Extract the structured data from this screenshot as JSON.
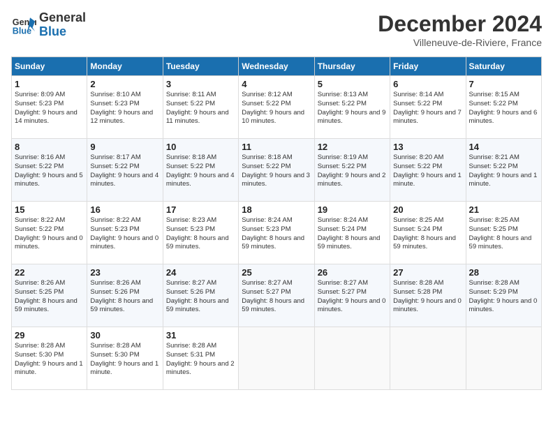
{
  "header": {
    "logo_general": "General",
    "logo_blue": "Blue",
    "month_title": "December 2024",
    "subtitle": "Villeneuve-de-Riviere, France"
  },
  "weekdays": [
    "Sunday",
    "Monday",
    "Tuesday",
    "Wednesday",
    "Thursday",
    "Friday",
    "Saturday"
  ],
  "weeks": [
    [
      {
        "day": "1",
        "sunrise": "Sunrise: 8:09 AM",
        "sunset": "Sunset: 5:23 PM",
        "daylight": "Daylight: 9 hours and 14 minutes."
      },
      {
        "day": "2",
        "sunrise": "Sunrise: 8:10 AM",
        "sunset": "Sunset: 5:23 PM",
        "daylight": "Daylight: 9 hours and 12 minutes."
      },
      {
        "day": "3",
        "sunrise": "Sunrise: 8:11 AM",
        "sunset": "Sunset: 5:22 PM",
        "daylight": "Daylight: 9 hours and 11 minutes."
      },
      {
        "day": "4",
        "sunrise": "Sunrise: 8:12 AM",
        "sunset": "Sunset: 5:22 PM",
        "daylight": "Daylight: 9 hours and 10 minutes."
      },
      {
        "day": "5",
        "sunrise": "Sunrise: 8:13 AM",
        "sunset": "Sunset: 5:22 PM",
        "daylight": "Daylight: 9 hours and 9 minutes."
      },
      {
        "day": "6",
        "sunrise": "Sunrise: 8:14 AM",
        "sunset": "Sunset: 5:22 PM",
        "daylight": "Daylight: 9 hours and 7 minutes."
      },
      {
        "day": "7",
        "sunrise": "Sunrise: 8:15 AM",
        "sunset": "Sunset: 5:22 PM",
        "daylight": "Daylight: 9 hours and 6 minutes."
      }
    ],
    [
      {
        "day": "8",
        "sunrise": "Sunrise: 8:16 AM",
        "sunset": "Sunset: 5:22 PM",
        "daylight": "Daylight: 9 hours and 5 minutes."
      },
      {
        "day": "9",
        "sunrise": "Sunrise: 8:17 AM",
        "sunset": "Sunset: 5:22 PM",
        "daylight": "Daylight: 9 hours and 4 minutes."
      },
      {
        "day": "10",
        "sunrise": "Sunrise: 8:18 AM",
        "sunset": "Sunset: 5:22 PM",
        "daylight": "Daylight: 9 hours and 4 minutes."
      },
      {
        "day": "11",
        "sunrise": "Sunrise: 8:18 AM",
        "sunset": "Sunset: 5:22 PM",
        "daylight": "Daylight: 9 hours and 3 minutes."
      },
      {
        "day": "12",
        "sunrise": "Sunrise: 8:19 AM",
        "sunset": "Sunset: 5:22 PM",
        "daylight": "Daylight: 9 hours and 2 minutes."
      },
      {
        "day": "13",
        "sunrise": "Sunrise: 8:20 AM",
        "sunset": "Sunset: 5:22 PM",
        "daylight": "Daylight: 9 hours and 1 minute."
      },
      {
        "day": "14",
        "sunrise": "Sunrise: 8:21 AM",
        "sunset": "Sunset: 5:22 PM",
        "daylight": "Daylight: 9 hours and 1 minute."
      }
    ],
    [
      {
        "day": "15",
        "sunrise": "Sunrise: 8:22 AM",
        "sunset": "Sunset: 5:22 PM",
        "daylight": "Daylight: 9 hours and 0 minutes."
      },
      {
        "day": "16",
        "sunrise": "Sunrise: 8:22 AM",
        "sunset": "Sunset: 5:23 PM",
        "daylight": "Daylight: 9 hours and 0 minutes."
      },
      {
        "day": "17",
        "sunrise": "Sunrise: 8:23 AM",
        "sunset": "Sunset: 5:23 PM",
        "daylight": "Daylight: 8 hours and 59 minutes."
      },
      {
        "day": "18",
        "sunrise": "Sunrise: 8:24 AM",
        "sunset": "Sunset: 5:23 PM",
        "daylight": "Daylight: 8 hours and 59 minutes."
      },
      {
        "day": "19",
        "sunrise": "Sunrise: 8:24 AM",
        "sunset": "Sunset: 5:24 PM",
        "daylight": "Daylight: 8 hours and 59 minutes."
      },
      {
        "day": "20",
        "sunrise": "Sunrise: 8:25 AM",
        "sunset": "Sunset: 5:24 PM",
        "daylight": "Daylight: 8 hours and 59 minutes."
      },
      {
        "day": "21",
        "sunrise": "Sunrise: 8:25 AM",
        "sunset": "Sunset: 5:25 PM",
        "daylight": "Daylight: 8 hours and 59 minutes."
      }
    ],
    [
      {
        "day": "22",
        "sunrise": "Sunrise: 8:26 AM",
        "sunset": "Sunset: 5:25 PM",
        "daylight": "Daylight: 8 hours and 59 minutes."
      },
      {
        "day": "23",
        "sunrise": "Sunrise: 8:26 AM",
        "sunset": "Sunset: 5:26 PM",
        "daylight": "Daylight: 8 hours and 59 minutes."
      },
      {
        "day": "24",
        "sunrise": "Sunrise: 8:27 AM",
        "sunset": "Sunset: 5:26 PM",
        "daylight": "Daylight: 8 hours and 59 minutes."
      },
      {
        "day": "25",
        "sunrise": "Sunrise: 8:27 AM",
        "sunset": "Sunset: 5:27 PM",
        "daylight": "Daylight: 8 hours and 59 minutes."
      },
      {
        "day": "26",
        "sunrise": "Sunrise: 8:27 AM",
        "sunset": "Sunset: 5:27 PM",
        "daylight": "Daylight: 9 hours and 0 minutes."
      },
      {
        "day": "27",
        "sunrise": "Sunrise: 8:28 AM",
        "sunset": "Sunset: 5:28 PM",
        "daylight": "Daylight: 9 hours and 0 minutes."
      },
      {
        "day": "28",
        "sunrise": "Sunrise: 8:28 AM",
        "sunset": "Sunset: 5:29 PM",
        "daylight": "Daylight: 9 hours and 0 minutes."
      }
    ],
    [
      {
        "day": "29",
        "sunrise": "Sunrise: 8:28 AM",
        "sunset": "Sunset: 5:30 PM",
        "daylight": "Daylight: 9 hours and 1 minute."
      },
      {
        "day": "30",
        "sunrise": "Sunrise: 8:28 AM",
        "sunset": "Sunset: 5:30 PM",
        "daylight": "Daylight: 9 hours and 1 minute."
      },
      {
        "day": "31",
        "sunrise": "Sunrise: 8:28 AM",
        "sunset": "Sunset: 5:31 PM",
        "daylight": "Daylight: 9 hours and 2 minutes."
      },
      null,
      null,
      null,
      null
    ]
  ]
}
